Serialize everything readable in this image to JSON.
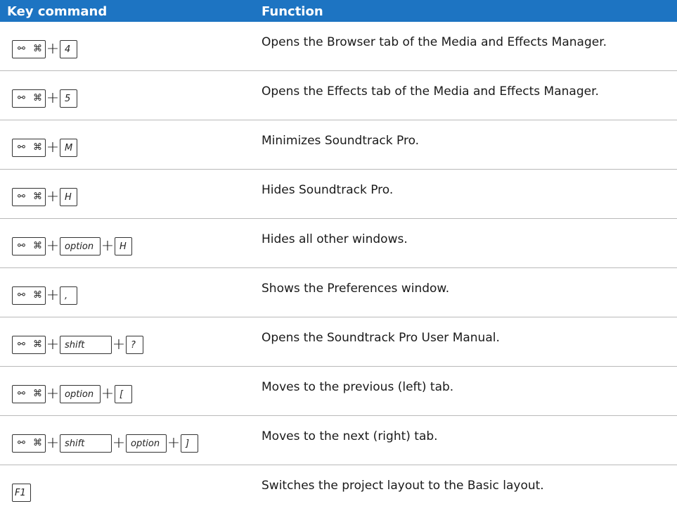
{
  "header": {
    "key_command": "Key command",
    "function": "Function"
  },
  "symbols": {
    "apple": "⌘",
    "command": "⌘",
    "plus": "+"
  },
  "rows": [
    {
      "keys": [
        "4"
      ],
      "function": "Opens the Browser tab of the Media and Effects Manager."
    },
    {
      "keys": [
        "5"
      ],
      "function": "Opens the Effects tab of the Media and Effects Manager."
    },
    {
      "keys": [
        "M"
      ],
      "function": "Minimizes Soundtrack Pro."
    },
    {
      "keys": [
        "H"
      ],
      "function": "Hides Soundtrack Pro."
    },
    {
      "keys": [
        "option",
        "H"
      ],
      "function": "Hides all other windows."
    },
    {
      "keys": [
        ","
      ],
      "function": "Shows the Preferences window."
    },
    {
      "keys": [
        "shift",
        "?"
      ],
      "function": "Opens the Soundtrack Pro User Manual."
    },
    {
      "keys": [
        "option",
        "["
      ],
      "function": "Moves to the previous (left) tab."
    },
    {
      "keys": [
        "shift",
        "option",
        "]"
      ],
      "function": "Moves to the next (right) tab."
    },
    {
      "keys": [
        "F1"
      ],
      "function": "Switches the project layout to the Basic layout."
    }
  ]
}
